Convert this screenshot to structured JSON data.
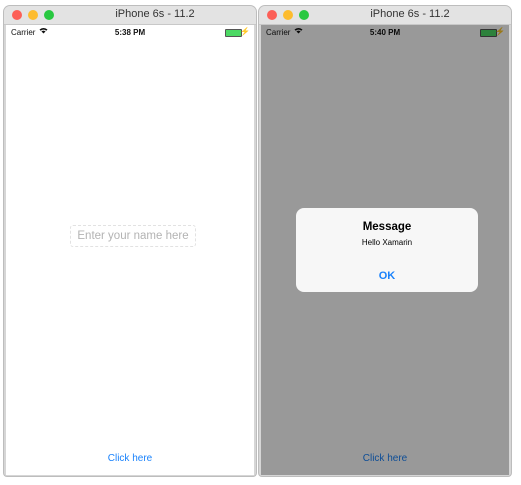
{
  "left_sim": {
    "window_title": "iPhone 6s - 11.2",
    "status": {
      "carrier": "Carrier",
      "time": "5:38 PM"
    },
    "entry_placeholder": "Enter your name here",
    "button_label": "Click here"
  },
  "right_sim": {
    "window_title": "iPhone 6s - 11.2",
    "status": {
      "carrier": "Carrier",
      "time": "5:40 PM"
    },
    "button_label": "Click here",
    "alert": {
      "title": "Message",
      "message": "Hello Xamarin",
      "ok_label": "OK"
    }
  },
  "colors": {
    "accent": "#1a82fb",
    "battery": "#4cd964",
    "close": "#fc5f57",
    "minimize": "#fdbc2e",
    "zoom": "#28c840"
  },
  "icons": [
    "wifi-icon",
    "battery-icon",
    "charging-icon"
  ]
}
